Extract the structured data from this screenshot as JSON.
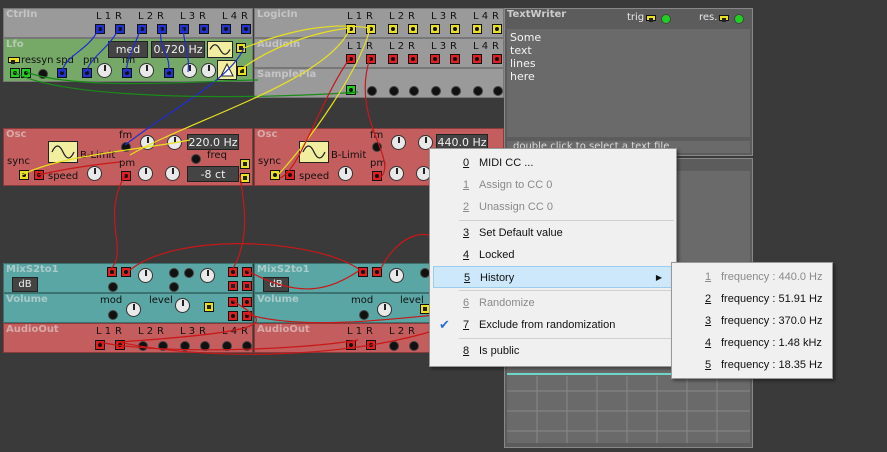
{
  "modules": {
    "ctrlin": {
      "title": "CtrlIn",
      "ports": [
        "L 1",
        "R",
        "L 2",
        "R",
        "L 3",
        "R",
        "L 4",
        "R"
      ]
    },
    "logicin": {
      "title": "LogicIn",
      "ports": [
        "L 1",
        "R",
        "L 2",
        "R",
        "L 3",
        "R",
        "L 4",
        "R"
      ]
    },
    "lfo": {
      "title": "Lfo",
      "res": "res",
      "syn": "syn",
      "spd": "spd",
      "pm": "pm",
      "fm": "fm",
      "speed_mode": "med",
      "freq": "0.720 Hz"
    },
    "audioin": {
      "title": "AudioIn",
      "ports": [
        "L 1",
        "R",
        "L 2",
        "R",
        "L 3",
        "R",
        "L 4",
        "R"
      ]
    },
    "sampleplay": {
      "title": "SamplePla"
    },
    "textwriter": {
      "title": "TextWriter",
      "trig": "trig",
      "res": "res.",
      "lines": [
        "Some",
        "text",
        "lines",
        "here"
      ],
      "hint": "double click to select a text file"
    },
    "osc1": {
      "title": "Osc",
      "fm": "fm",
      "pm": "pm",
      "freq_label": "freq",
      "limit": "B-Limit",
      "sync": "sync",
      "speed": "speed",
      "freq": "220.0 Hz",
      "detune": "-8 ct"
    },
    "osc2": {
      "title": "Osc",
      "fm": "fm",
      "pm": "pm",
      "limit": "B-Limit",
      "sync": "sync",
      "speed": "speed",
      "freq": "440.0 Hz"
    },
    "mix1": {
      "title": "MixS2to1",
      "unit": "dB"
    },
    "mix2": {
      "title": "MixS2to1",
      "unit": "dB"
    },
    "volume1": {
      "title": "Volume",
      "mod": "mod",
      "level": "level"
    },
    "volume2": {
      "title": "Volume",
      "mod": "mod",
      "level": "level"
    },
    "audioout1": {
      "title": "AudioOut",
      "ports": [
        "L 1",
        "R",
        "L 2",
        "R",
        "L 3",
        "R",
        "L 4",
        "R"
      ]
    },
    "audioout2": {
      "title": "AudioOut",
      "ports": [
        "L 1",
        "R",
        "L 2",
        "R",
        "L 3",
        "R",
        "L 4",
        "R"
      ]
    }
  },
  "context_menu": {
    "items": [
      {
        "num": "0",
        "label": "MIDI CC ..."
      },
      {
        "num": "1",
        "label": "Assign to CC 0"
      },
      {
        "num": "2",
        "label": "Unassign CC 0"
      },
      {
        "num": "3",
        "label": "Set Default value"
      },
      {
        "num": "4",
        "label": "Locked"
      },
      {
        "num": "5",
        "label": "History"
      },
      {
        "num": "6",
        "label": "Randomize"
      },
      {
        "num": "7",
        "label": "Exclude from randomization"
      },
      {
        "num": "8",
        "label": "Is public"
      }
    ]
  },
  "history_menu": {
    "items": [
      {
        "num": "1",
        "label": "frequency : 440.0 Hz"
      },
      {
        "num": "2",
        "label": "frequency : 51.91 Hz"
      },
      {
        "num": "3",
        "label": "frequency : 370.0 Hz"
      },
      {
        "num": "4",
        "label": "frequency : 1.48 kHz"
      },
      {
        "num": "5",
        "label": "frequency : 18.35 Hz"
      }
    ]
  },
  "colors": {
    "cable_blue": "#1f2fd0",
    "cable_yellow": "#e8e020",
    "cable_red": "#c81818",
    "cable_green": "#1a8a1a",
    "highlight": "#cde8fa"
  }
}
